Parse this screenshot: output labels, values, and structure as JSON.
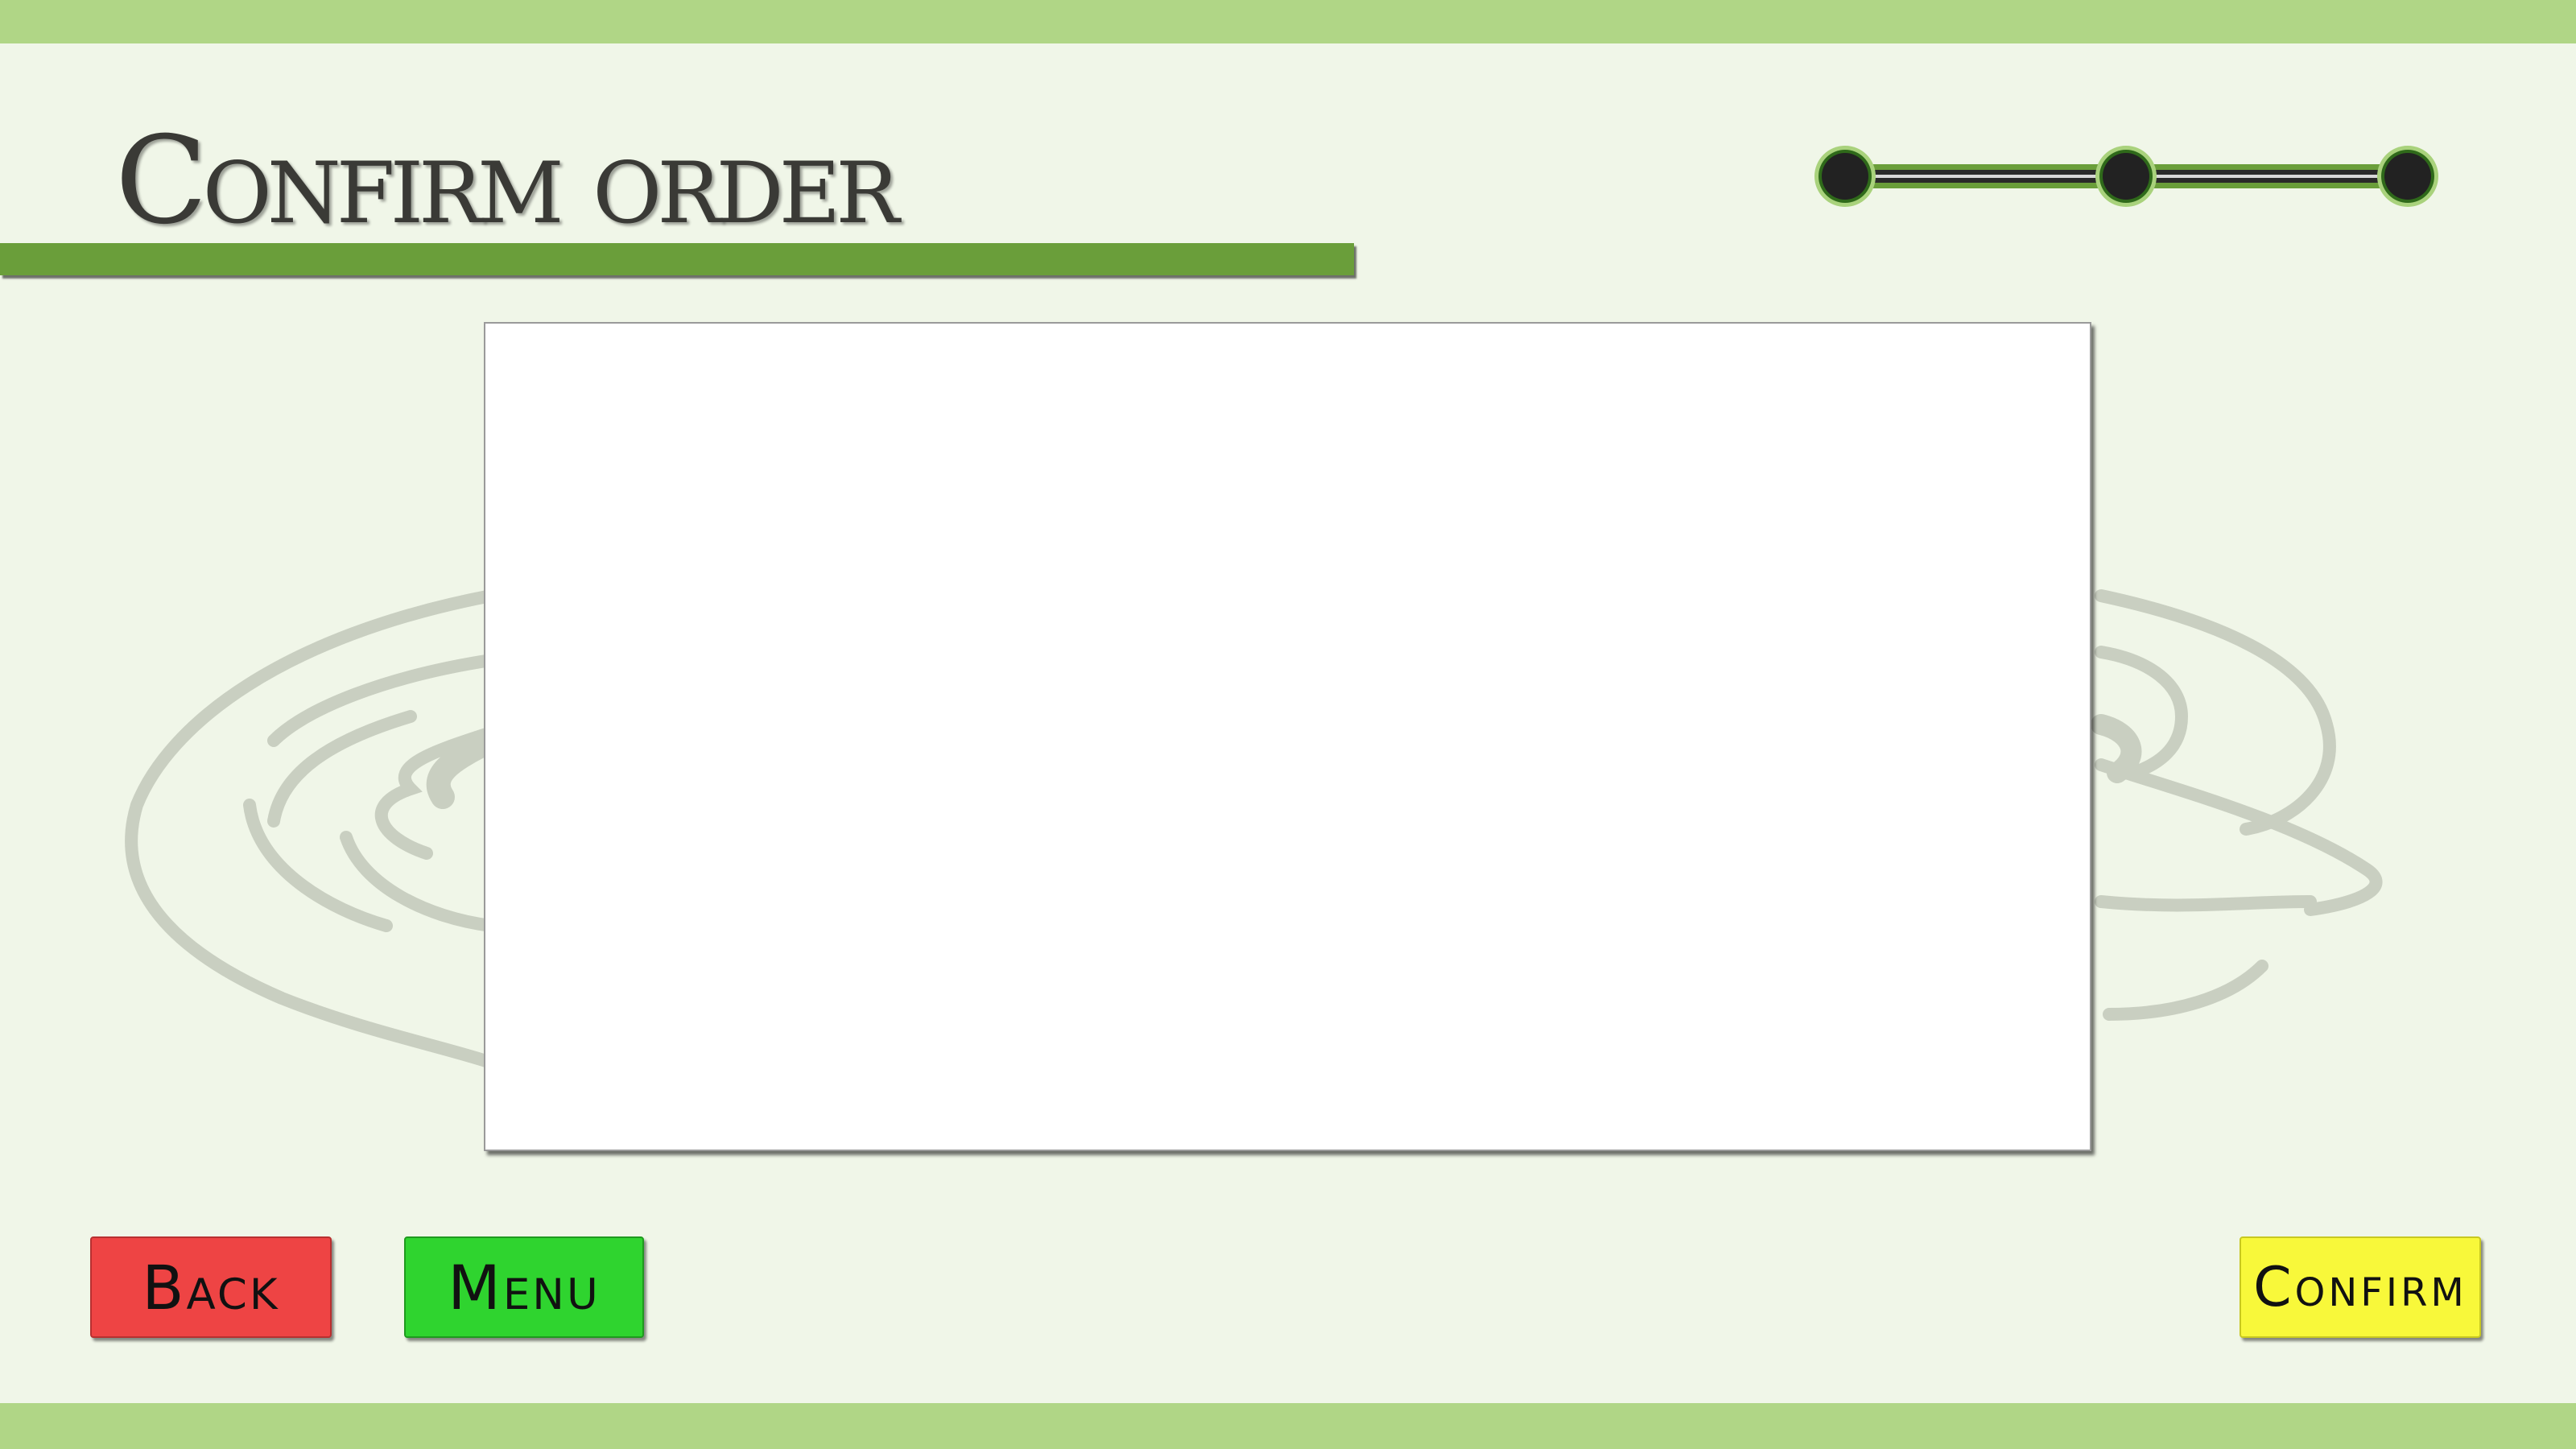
{
  "header": {
    "title": "Confirm order"
  },
  "progress": {
    "total_steps": 3,
    "icon": "step-progress-indicator"
  },
  "footer": {
    "back_label": "Back",
    "menu_label": "Menu",
    "confirm_label": "Confirm"
  },
  "colors": {
    "accent_bar": "#b0d686",
    "underline": "#6a9e3a",
    "background": "#f0f6e8",
    "back_button": "#ee4444",
    "menu_button": "#2fd42f",
    "confirm_button": "#f8f83a"
  }
}
